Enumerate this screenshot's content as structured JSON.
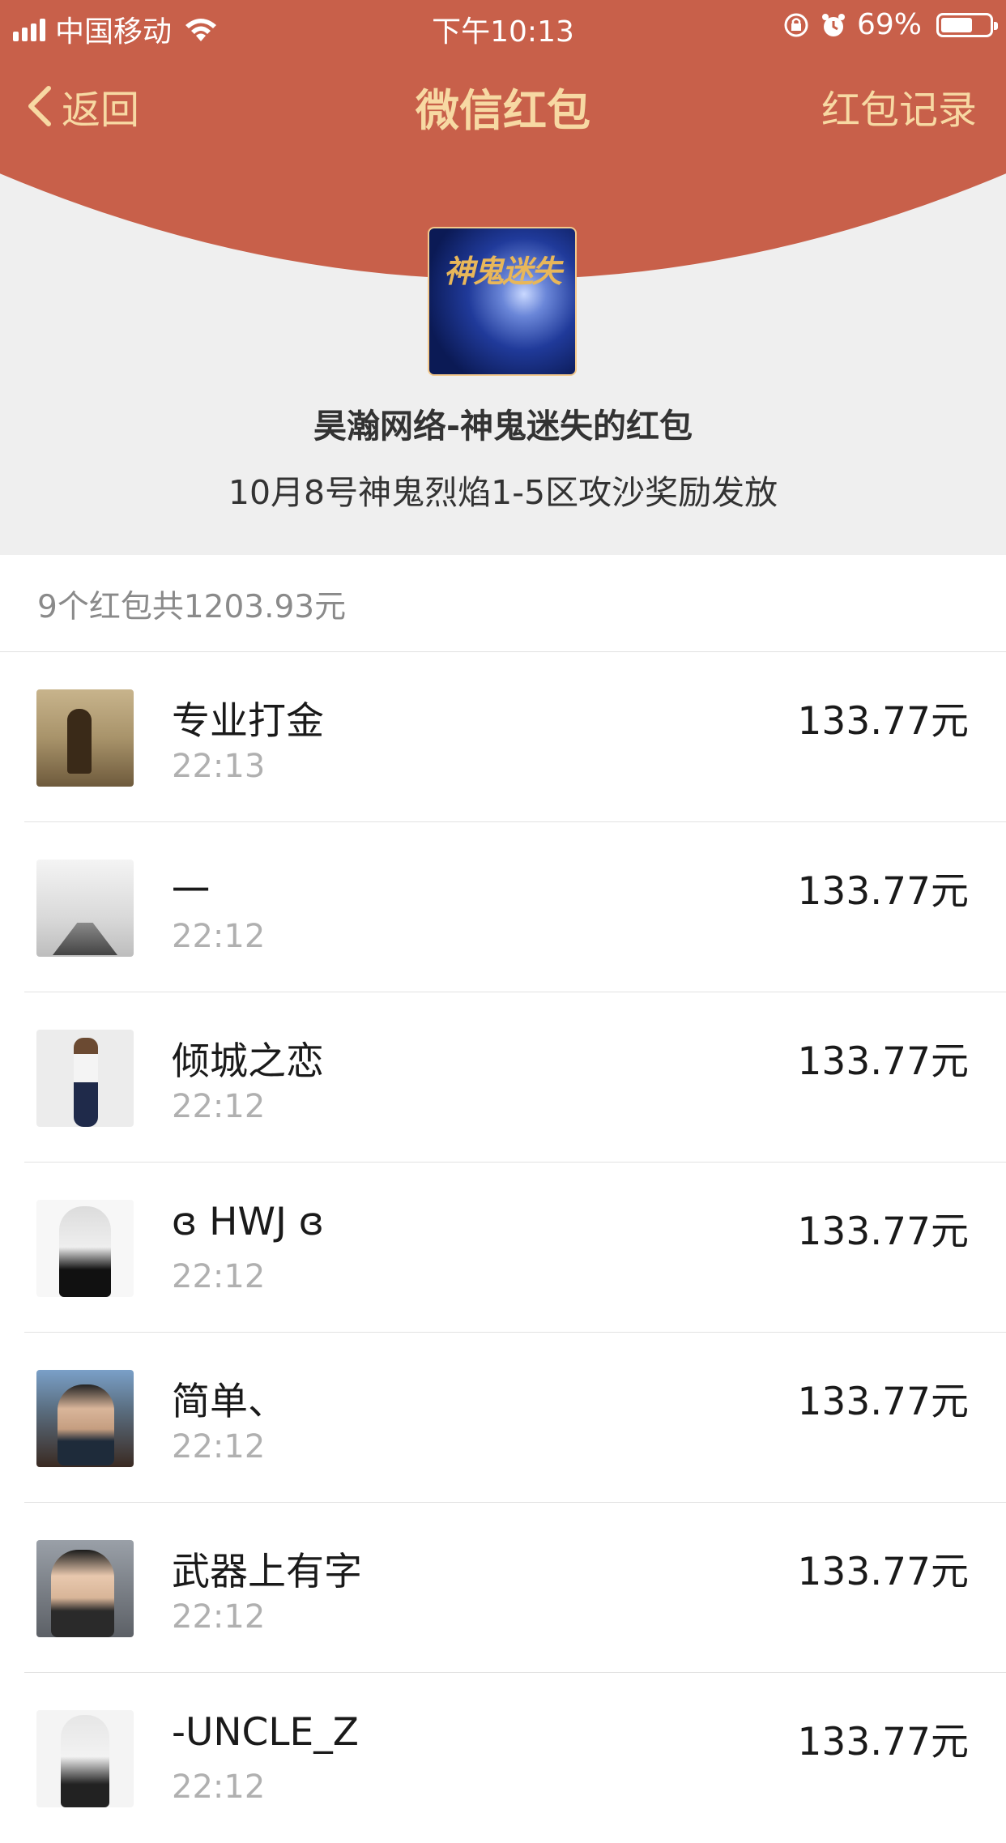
{
  "status_bar": {
    "carrier": "中国移动",
    "time": "下午10:13",
    "battery": "69%",
    "battery_level": 0.69
  },
  "nav": {
    "back_label": "返回",
    "title": "微信红包",
    "record_label": "红包记录"
  },
  "colors": {
    "header_red": "#c8604a",
    "gold_text": "#f7d9a3",
    "page_gray": "#efefef"
  },
  "sender": {
    "logo_text": "神鬼迷失",
    "name": "昊瀚网络-神鬼迷失的红包",
    "message": "10月8号神鬼烈焰1-5区攻沙奖励发放"
  },
  "summary": "9个红包共1203.93元",
  "recipients": [
    {
      "name": "专业打金",
      "time": "22:13",
      "amount": "133.77元"
    },
    {
      "name": "一",
      "time": "22:12",
      "amount": "133.77元"
    },
    {
      "name": "倾城之恋",
      "time": "22:12",
      "amount": "133.77元"
    },
    {
      "name": "ɞ HWJ ɞ",
      "time": "22:12",
      "amount": "133.77元"
    },
    {
      "name": "简单、",
      "time": "22:12",
      "amount": "133.77元"
    },
    {
      "name": "武器上有字",
      "time": "22:12",
      "amount": "133.77元"
    },
    {
      "name": "-UNCLE_Z",
      "time": "22:12",
      "amount": "133.77元"
    }
  ]
}
